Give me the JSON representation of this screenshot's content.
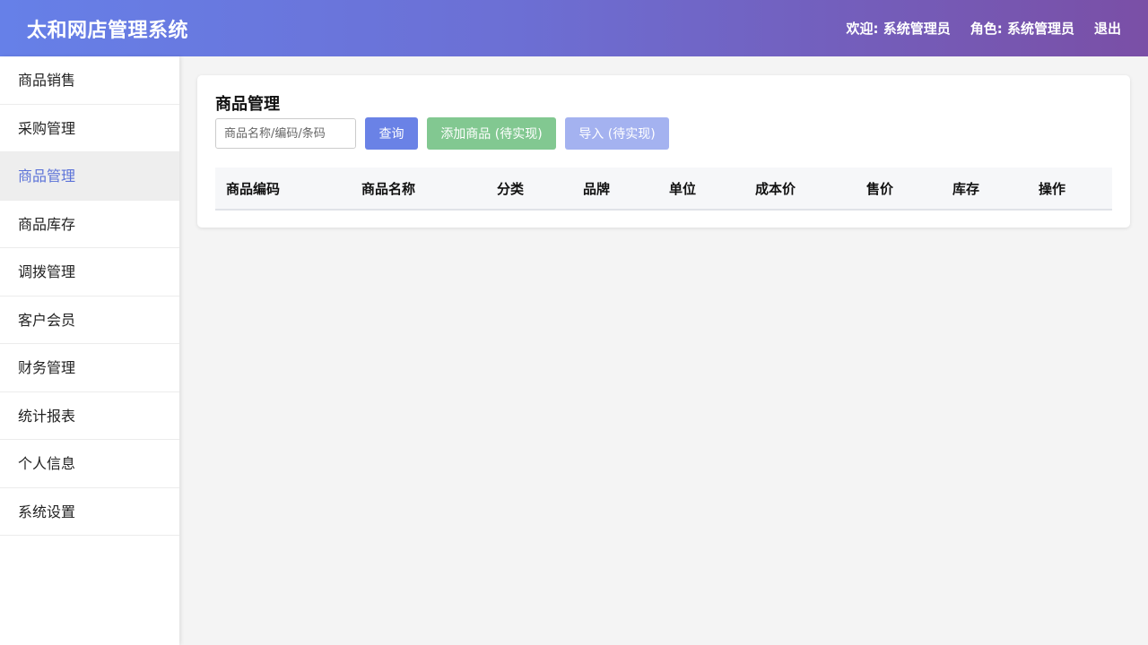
{
  "header": {
    "title": "太和网店管理系统",
    "welcome": "欢迎: 系统管理员",
    "role": "角色: 系统管理员",
    "logout": "退出"
  },
  "sidebar": {
    "items": [
      {
        "label": "商品销售"
      },
      {
        "label": "采购管理"
      },
      {
        "label": "商品管理"
      },
      {
        "label": "商品库存"
      },
      {
        "label": "调拨管理"
      },
      {
        "label": "客户会员"
      },
      {
        "label": "财务管理"
      },
      {
        "label": "统计报表"
      },
      {
        "label": "个人信息"
      },
      {
        "label": "系统设置"
      }
    ],
    "active_index": 2
  },
  "main": {
    "title": "商品管理",
    "search": {
      "placeholder": "商品名称/编码/条码",
      "value": ""
    },
    "buttons": {
      "query": "查询",
      "add": "添加商品 (待实现)",
      "import": "导入 (待实现)"
    },
    "table": {
      "columns": [
        "商品编码",
        "商品名称",
        "分类",
        "品牌",
        "单位",
        "成本价",
        "售价",
        "库存",
        "操作"
      ],
      "rows": []
    }
  },
  "colors": {
    "header_gradient_start": "#6680e8",
    "header_gradient_end": "#7a4fa6",
    "accent": "#5b72d8",
    "query_button": "#6a82e6",
    "add_button": "#82c891",
    "import_button": "#a4b2f0"
  }
}
